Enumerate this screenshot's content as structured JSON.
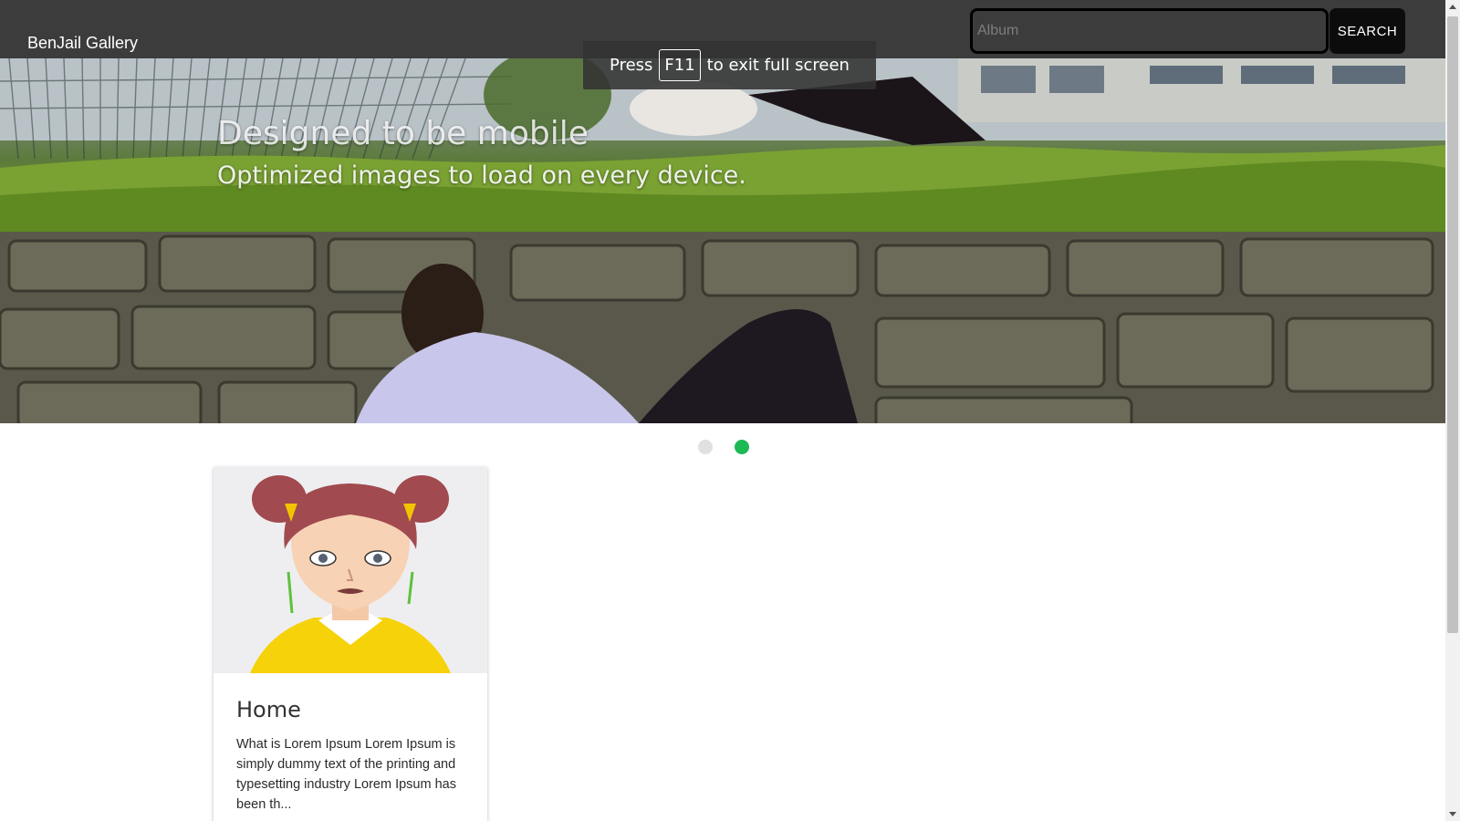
{
  "navbar": {
    "brand": "BenJail Gallery",
    "search": {
      "placeholder": "Album",
      "value": ""
    },
    "search_button": "SEARCH",
    "background": "#3c3c3c"
  },
  "fullscreen_notice": {
    "prefix": "Press",
    "key": "F11",
    "suffix": "to exit full screen"
  },
  "hero": {
    "title": "Designed to be mobile",
    "subtitle": "Optimized images to load on every device."
  },
  "carousel": {
    "slide_count": 2,
    "active_index": 1,
    "active_color": "#1db954",
    "inactive_color": "#e0e0e0"
  },
  "cards": [
    {
      "title": "Home",
      "text": "What is Lorem Ipsum Lorem Ipsum is simply dummy text of the printing and typesetting industry Lorem Ipsum has been th..."
    }
  ]
}
